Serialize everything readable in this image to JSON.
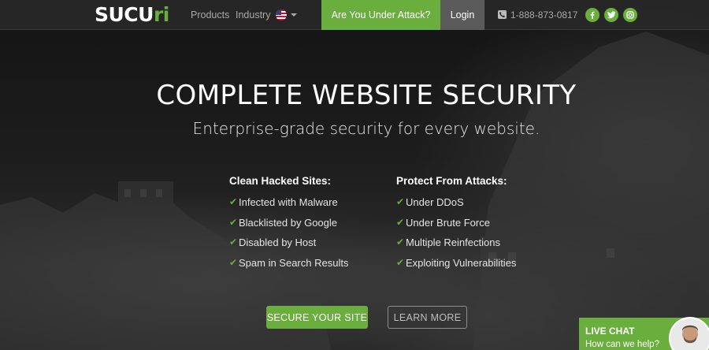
{
  "nav": {
    "logo_main": "SUCU",
    "logo_accent": "ri",
    "products": "Products",
    "industry": "Industry",
    "attack_button": "Are You Under Attack?",
    "login": "Login",
    "phone": "1-888-873-0817"
  },
  "hero": {
    "headline": "COMPLETE WEBSITE SECURITY",
    "subhead": "Enterprise-grade security for every website.",
    "left_title": "Clean Hacked Sites:",
    "left_items": [
      "Infected with Malware",
      "Blacklisted by Google",
      "Disabled by Host",
      "Spam in Search Results"
    ],
    "right_title": "Protect From Attacks:",
    "right_items": [
      "Under DDoS",
      "Under Brute Force",
      "Multiple Reinfections",
      "Exploiting Vulnerabilities"
    ],
    "cta_primary": "SECURE YOUR SITE",
    "cta_secondary": "LEARN MORE"
  },
  "chat": {
    "title": "LIVE CHAT",
    "subtitle": "How can we help?"
  },
  "colors": {
    "accent": "#6aae3d",
    "nav_bg": "#282828",
    "login_bg": "#5a5a5a"
  },
  "icons": [
    "flag-us-icon",
    "chevron-down-icon",
    "phone-icon",
    "facebook-icon",
    "twitter-icon",
    "instagram-icon",
    "check-icon"
  ]
}
